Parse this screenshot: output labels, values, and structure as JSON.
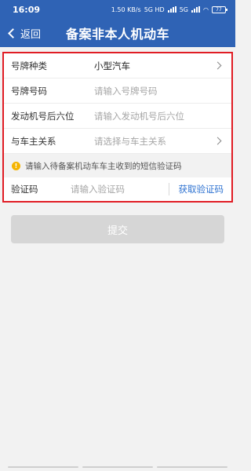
{
  "status_bar": {
    "time": "16:09",
    "net_speed": "1.50 KB/s",
    "network_1": "5G HD",
    "network_2": "5G",
    "battery": "77"
  },
  "nav": {
    "back_label": "返回",
    "title": "备案非本人机动车"
  },
  "form": {
    "rows": [
      {
        "label": "号牌种类",
        "value": "小型汽车",
        "has_arrow": true
      },
      {
        "label": "号牌号码",
        "placeholder": "请输入号牌号码"
      },
      {
        "label": "发动机号后六位",
        "placeholder": "请输入发动机号后六位"
      },
      {
        "label": "与车主关系",
        "placeholder": "请选择与车主关系",
        "has_arrow": true
      }
    ],
    "hint": "请输入待备案机动车车主收到的短信验证码",
    "code": {
      "label": "验证码",
      "placeholder": "请输入验证码",
      "get_code_label": "获取验证码"
    }
  },
  "submit_label": "提交",
  "colors": {
    "header_bg": "#2f63b5",
    "highlight_border": "#e01c24",
    "link": "#2f73d1",
    "button_disabled": "#d6d6d6",
    "warning": "#f5b400"
  }
}
